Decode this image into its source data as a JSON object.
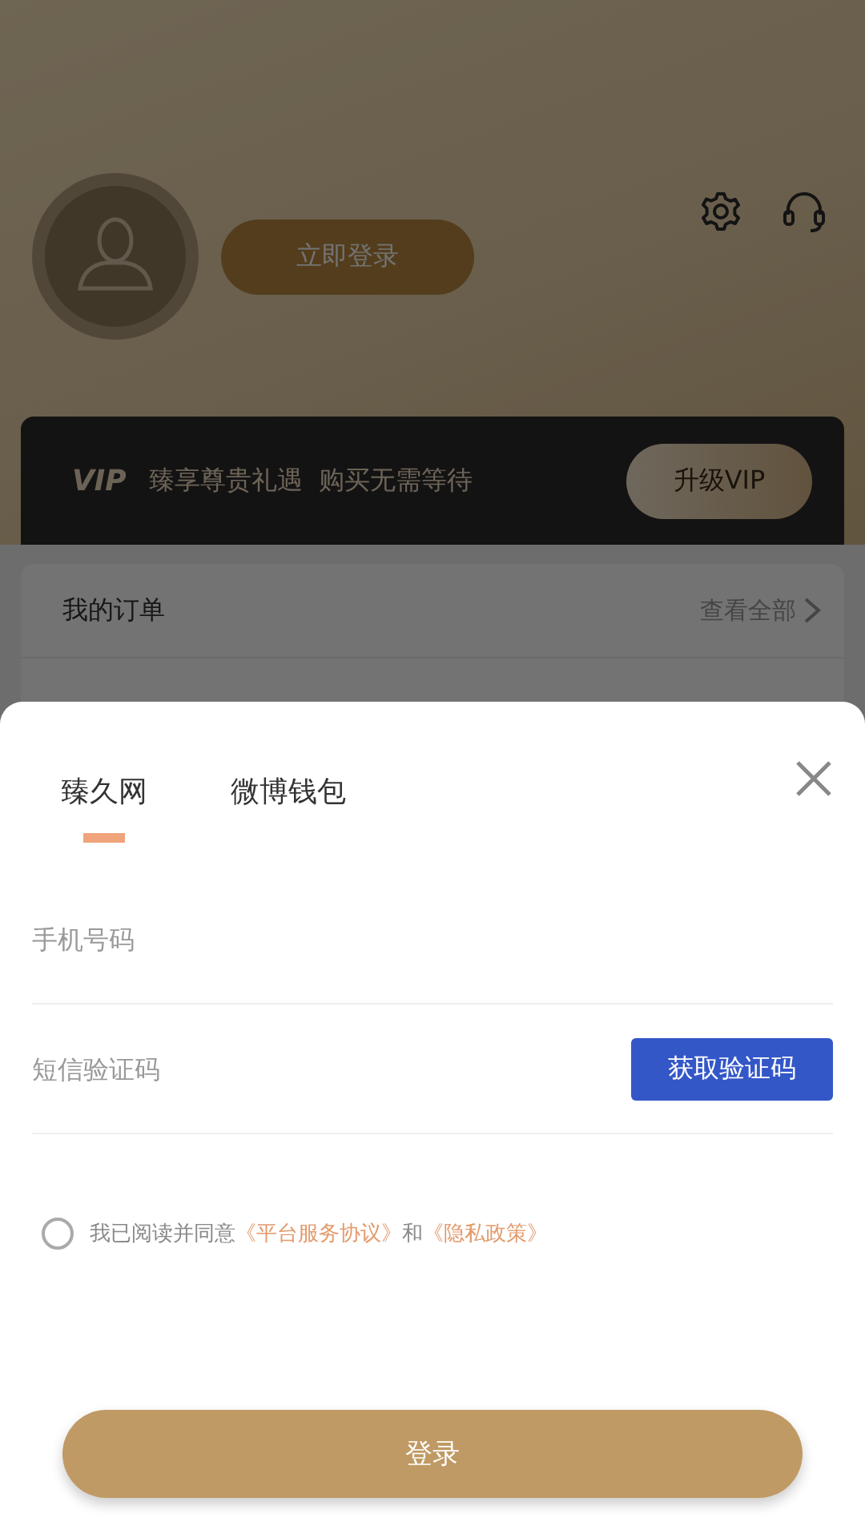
{
  "header": {
    "login_button": "立即登录"
  },
  "vip_banner": {
    "logo": "VIP",
    "text": "臻享尊贵礼遇  购买无需等待",
    "button": "升级VIP"
  },
  "orders": {
    "title": "我的订单",
    "link": "查看全部"
  },
  "login_sheet": {
    "tabs": [
      {
        "label": "臻久网",
        "selected": true
      },
      {
        "label": "微博钱包",
        "selected": false
      }
    ],
    "phone_field": {
      "placeholder": "手机号码"
    },
    "code_field": {
      "placeholder": "短信验证码"
    },
    "code_button": "获取验证码",
    "agreement": {
      "checked": false,
      "parts": [
        {
          "kind": "text",
          "text": "我已阅读并同意"
        },
        {
          "kind": "link",
          "text": "《平台服务协议》"
        },
        {
          "kind": "text",
          "text": "和"
        },
        {
          "kind": "link",
          "text": "《隐私政策》"
        }
      ]
    },
    "submit_button": "登录"
  }
}
